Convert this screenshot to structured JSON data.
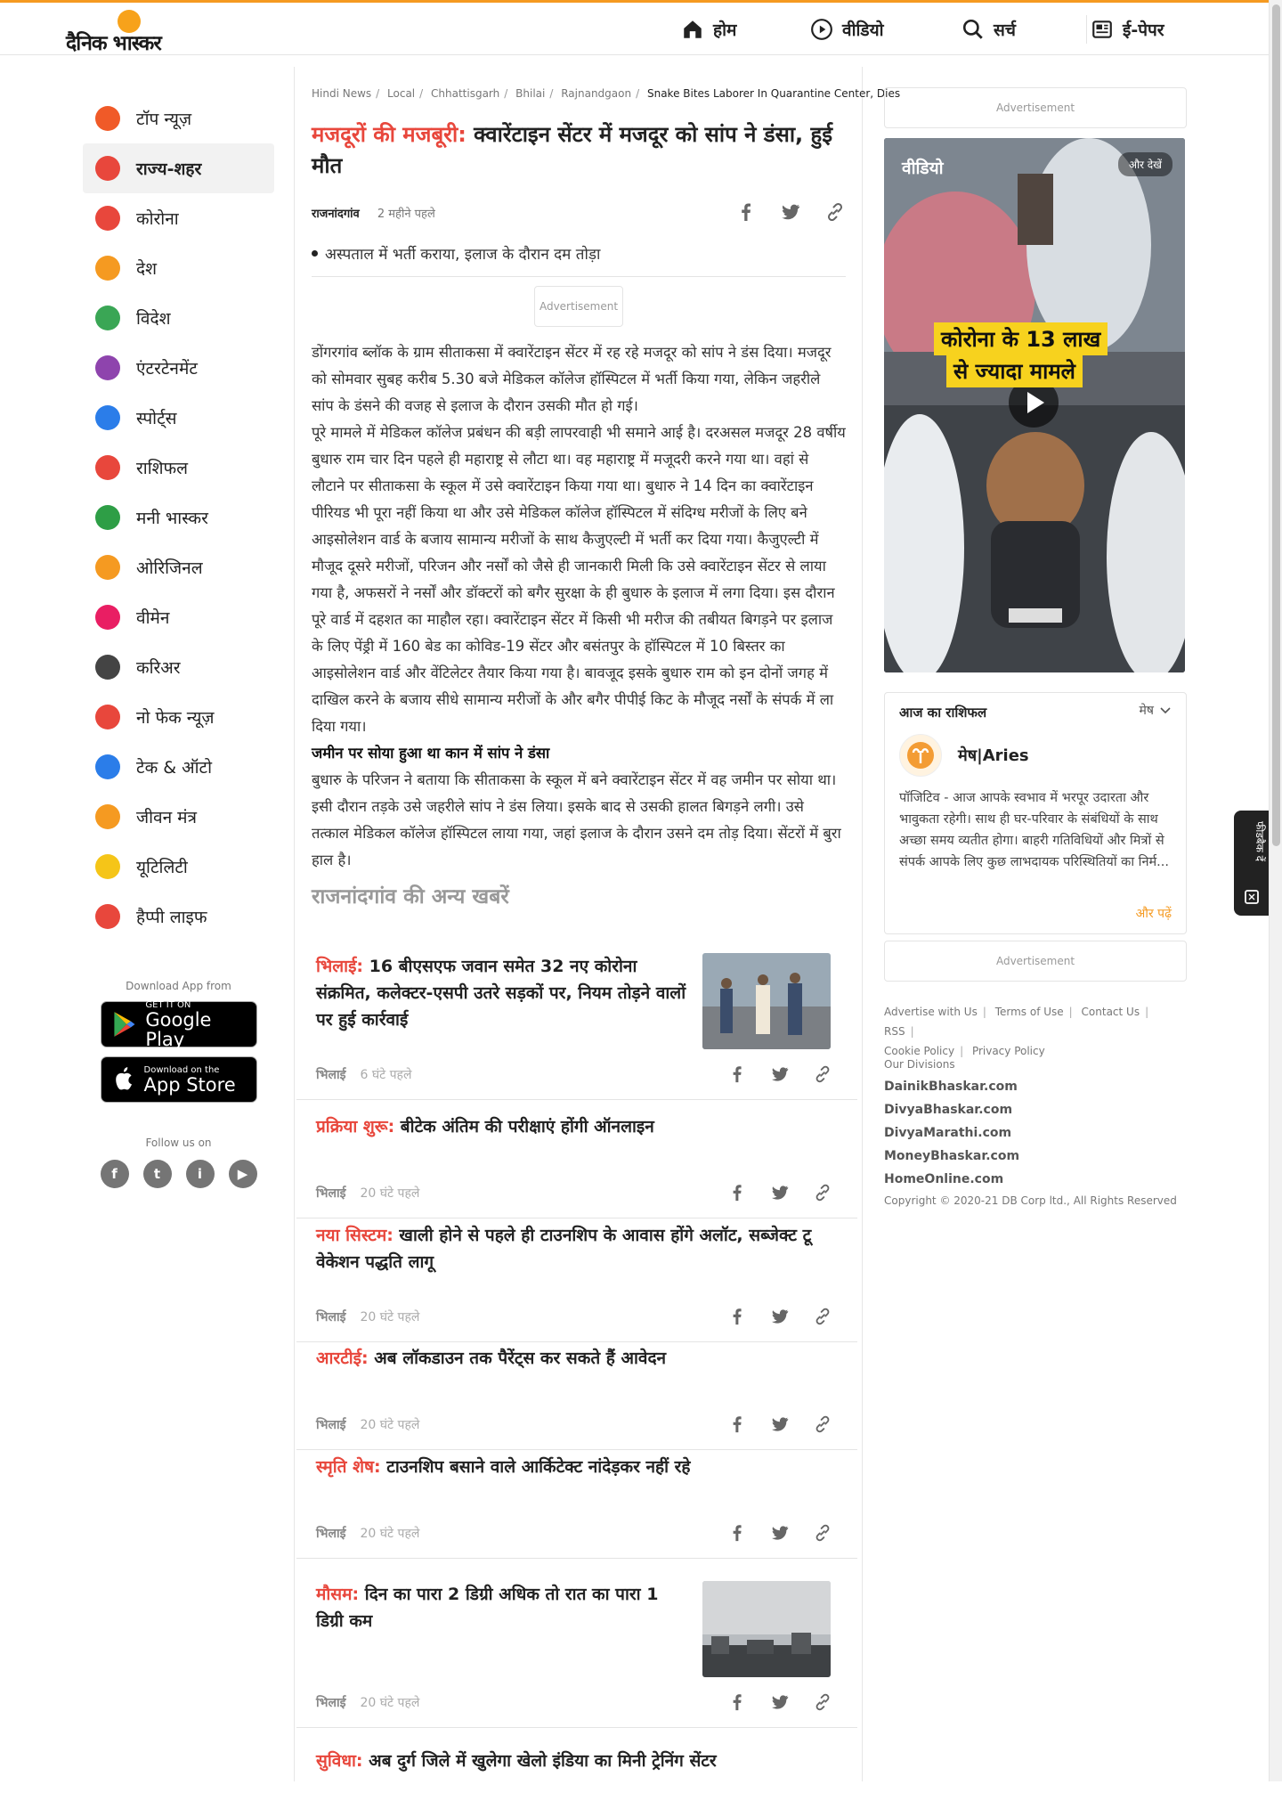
{
  "brand": {
    "logo_text": "दैनिक भास्कर"
  },
  "nav": [
    {
      "label": "होम",
      "icon": "home-icon"
    },
    {
      "label": "वीडियो",
      "icon": "play-circle-icon"
    },
    {
      "label": "सर्च",
      "icon": "search-icon"
    },
    {
      "label": "ई-पेपर",
      "icon": "newspaper-icon"
    }
  ],
  "sidebar": {
    "items": [
      {
        "label": "टॉप न्यूज़",
        "icon": "fire-icon",
        "color": "#f05a28"
      },
      {
        "label": "राज्य-शहर",
        "icon": "city-icon",
        "color": "#e8473c",
        "active": true
      },
      {
        "label": "कोरोना",
        "icon": "virus-icon",
        "color": "#e8473c"
      },
      {
        "label": "देश",
        "icon": "india-gate-icon",
        "color": "#f59a21"
      },
      {
        "label": "विदेश",
        "icon": "globe-icon",
        "color": "#3aa655"
      },
      {
        "label": "एंटरटेनमेंट",
        "icon": "clapper-icon",
        "color": "#8e44ad"
      },
      {
        "label": "स्पोर्ट्स",
        "icon": "runner-icon",
        "color": "#2b7de9"
      },
      {
        "label": "राशिफल",
        "icon": "zodiac-icon",
        "color": "#e8473c"
      },
      {
        "label": "मनी भास्कर",
        "icon": "rupee-icon",
        "color": "#2e9e46"
      },
      {
        "label": "ओरिजिनल",
        "icon": "original-icon",
        "color": "#f59a21"
      },
      {
        "label": "वीमेन",
        "icon": "women-icon",
        "color": "#e91e63"
      },
      {
        "label": "करिअर",
        "icon": "graduation-cap-icon",
        "color": "#444444"
      },
      {
        "label": "नो फेक न्यूज़",
        "icon": "no-fake-icon",
        "color": "#e8473c"
      },
      {
        "label": "टेक & ऑटो",
        "icon": "tech-auto-icon",
        "color": "#2b7de9"
      },
      {
        "label": "जीवन मंत्र",
        "icon": "kalash-icon",
        "color": "#f59a21"
      },
      {
        "label": "यूटिलिटी",
        "icon": "bulb-icon",
        "color": "#f5c518"
      },
      {
        "label": "हैप्पी लाइफ",
        "icon": "heart-icon",
        "color": "#e8473c"
      }
    ]
  },
  "app": {
    "download_label": "Download App from",
    "google_small": "GET IT ON",
    "google_big": "Google Play",
    "apple_small": "Download on the",
    "apple_big": "App Store",
    "follow_label": "Follow us on",
    "social": [
      "f",
      "t",
      "i",
      "▶"
    ]
  },
  "article": {
    "breadcrumbs": [
      "Hindi News",
      "Local",
      "Chhattisgarh",
      "Bhilai",
      "Rajnandgaon"
    ],
    "breadcrumb_current": "Snake Bites Laborer In Quarantine Center, Dies",
    "kicker": "मजदूरों की मजबूरी:",
    "title": "क्वारेंटाइन सेंटर में मजदूर को सांप ने डंसा, हुई मौत",
    "city": "राजनांदगांव",
    "time": "2 महीने पहले",
    "bullet": "अस्पताल में भर्ती कराया, इलाज के दौरान दम तोड़ा",
    "ad_label": "Advertisement",
    "para1": "डोंगरगांव ब्लॉक के ग्राम सीताकसा में क्वारेंटाइन सेंटर में रह रहे मजदूर को सांप ने डंस दिया। मजदूर को सोमवार सुबह करीब 5.30 बजे मेडिकल कॉलेज हॉस्पिटल में भर्ती किया गया, लेकिन जहरीले सांप के डंसने की वजह से इलाज के दौरान उसकी मौत हो गई।",
    "para2": "पूरे मामले में मेडिकल कॉलेज प्रबंधन की बड़ी लापरवाही भी समाने आई है। दरअसल मजदूर 28 वर्षीय बुधारु राम चार दिन पहले ही महाराष्ट्र से लौटा था। वह महाराष्ट्र में मजूदरी करने गया था। वहां से लौटाने पर सीताकसा के स्कूल में उसे क्वारेंटाइन किया गया था। बुधारु ने 14 दिन का क्वारेंटाइन पीरियड भी पूरा नहीं किया था और उसे मेडिकल कॉलेज हॉस्पिटल में संदिग्ध मरीजों के लिए बने आइसोलेशन वार्ड के बजाय सामान्य मरीजों के साथ कैजुएल्टी में भर्ती कर दिया गया। कैजुएल्टी में मौजूद दूसरे मरीजों, परिजन और नर्सों को जैसे ही जानकारी मिली कि उसे क्वारेंटाइन सेंटर से लाया गया है, अफसरों ने नर्सों और डॉक्टरों को बगैर सुरक्षा के ही बुधारु के इलाज में लगा दिया। इस दौरान पूरे वार्ड में दहशत का माहौल रहा। क्वारेंटाइन सेंटर में किसी भी मरीज की तबीयत बिगड़ने पर इलाज के लिए पेंड्री में 160 बेड का कोविड-19 सेंटर और बसंतपुर के हॉस्पिटल में 10 बिस्तर का आइसोलेशन वार्ड और वेंटिलेटर तैयार किया गया है। बावजूद इसके बुधारु राम को इन दोनों जगह में दाखिल करने के बजाय सीधे सामान्य मरीजों के और बगैर पीपीई किट के मौजूद नर्सों के संपर्क में ला दिया गया।",
    "subhead": "जमीन पर सोया हुआ था कान में सांप ने डंसा",
    "para3": "बुधारु के परिजन ने बताया कि सीताकसा के स्कूल में बने क्वारेंटाइन सेंटर में वह जमीन पर सोया था। इसी दौरान तड़के उसे जहरीले सांप ने डंस लिया। इसके बाद से उसकी हालत बिगड़ने लगी। उसे तत्काल मेडिकल कॉलेज हॉस्पिटल लाया गया, जहां इलाज के दौरान उसने दम तोड़ दिया। सेंटरों में बुरा हाल है।",
    "other_news_head": "राजनांदगांव की अन्य खबरें"
  },
  "news": [
    {
      "kicker": "भिलाई:",
      "title": "16 बीएसएफ जवान समेत 32 नए कोरोना संक्रमित, कलेक्टर-एसपी उतरे सड़कों पर, नियम तोड़ने वालों पर हुई कार्रवाई",
      "city": "भिलाई",
      "time": "6 घंटे पहले",
      "has_image": true
    },
    {
      "kicker": "प्रक्रिया शुरू:",
      "title": "बीटेक अंतिम की परीक्षाएं होंगी ऑनलाइन",
      "city": "भिलाई",
      "time": "20 घंटे पहले",
      "has_image": false
    },
    {
      "kicker": "नया सिस्टम:",
      "title": "खाली होने से पहले ही टाउनशिप के आवास होंगे अलॉट, सब्जेक्ट टू वेकेशन पद्धति लागू",
      "city": "भिलाई",
      "time": "20 घंटे पहले",
      "has_image": false
    },
    {
      "kicker": "आरटीई:",
      "title": "अब लॉकडाउन तक पैरेंट्स कर सकते हैं आवेदन",
      "city": "भिलाई",
      "time": "20 घंटे पहले",
      "has_image": false
    },
    {
      "kicker": "स्मृति शेष:",
      "title": "टाउनशिप बसाने वाले आर्किटेक्ट नांदेड़कर नहीं रहे",
      "city": "भिलाई",
      "time": "20 घंटे पहले",
      "has_image": false
    },
    {
      "kicker": "मौसम:",
      "title": "दिन का पारा 2 डिग्री अधिक तो रात का पारा 1 डिग्री कम",
      "city": "भिलाई",
      "time": "20 घंटे पहले",
      "has_image": true
    },
    {
      "kicker": "सुविधा:",
      "title": "अब दुर्ग जिले में खुलेगा खेलो इंडिया का मिनी ट्रेनिंग सेंटर",
      "city": "",
      "time": "",
      "has_image": false
    }
  ],
  "rail": {
    "ad_label": "Advertisement",
    "video_label": "वीडियो",
    "video_more": "और देखें",
    "video_caption_1": "कोरोना के 13 लाख",
    "video_caption_2": "से ज्यादा मामले",
    "horoscope_title": "आज का राशिफल",
    "horoscope_select": "मेष",
    "sign_name": "मेष|Aries",
    "horoscope_text": "पॉजिटिव - आज आपके स्वभाव में भरपूर उदारता और भावुकता रहेगी। साथ ही घर-परिवार के संबंधियों के साथ अच्छा समय व्यतीत होगा। बाहरी गतिविधियों और मित्रों से संपर्क आपके लिए कुछ लाभदायक परिस्थितियों का निर्म...",
    "read_more": "और पढ़ें",
    "footer_links": [
      "Advertise with Us",
      "Terms of Use",
      "Contact Us",
      "RSS",
      "Cookie Policy",
      "Privacy Policy"
    ],
    "divisions_label": "Our Divisions",
    "divisions": [
      "DainikBhaskar.com",
      "DivyaBhaskar.com",
      "DivyaMarathi.com",
      "MoneyBhaskar.com",
      "HomeOnline.com"
    ],
    "copyright": "Copyright © 2020-21 DB Corp ltd., All Rights Reserved"
  },
  "feedback_label": "फीडबैक दें",
  "colors": {
    "brand_orange": "#f59a21",
    "kicker_red": "#e8473c"
  }
}
